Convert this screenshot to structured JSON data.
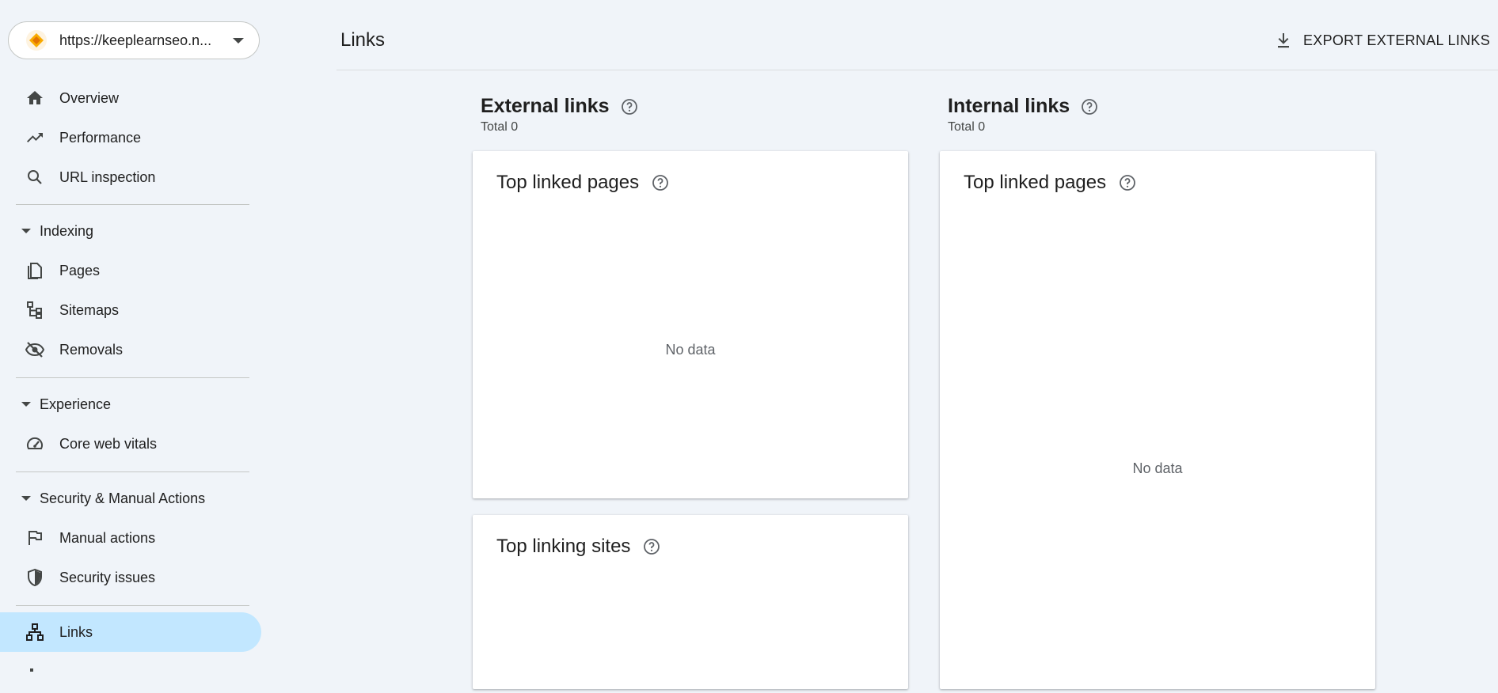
{
  "property": {
    "url": "https://keeplearnseo.n..."
  },
  "nav": {
    "overview": "Overview",
    "performance": "Performance",
    "url_inspection": "URL inspection",
    "indexing": "Indexing",
    "pages": "Pages",
    "sitemaps": "Sitemaps",
    "removals": "Removals",
    "experience": "Experience",
    "core_web_vitals": "Core web vitals",
    "security": "Security & Manual Actions",
    "manual_actions": "Manual actions",
    "security_issues": "Security issues",
    "links": "Links"
  },
  "header": {
    "title": "Links",
    "export_label": "EXPORT EXTERNAL LINKS"
  },
  "external": {
    "title": "External links",
    "total": "Total 0",
    "top_linked_pages": {
      "title": "Top linked pages",
      "empty": "No data"
    },
    "top_linking_sites": {
      "title": "Top linking sites"
    }
  },
  "internal": {
    "title": "Internal links",
    "total": "Total 0",
    "top_linked_pages": {
      "title": "Top linked pages",
      "empty": "No data"
    }
  },
  "colors": {
    "active_bg": "#c2e7ff",
    "background": "#f0f4f9",
    "logo_orange": "#f9ab00"
  }
}
